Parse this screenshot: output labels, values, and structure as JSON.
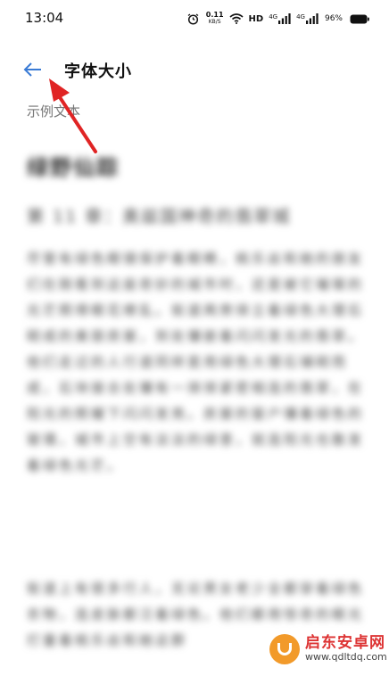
{
  "status_bar": {
    "time": "13:04",
    "net_speed_value": "0.11",
    "net_speed_unit": "KB/S",
    "hd_label": "HD",
    "signal1_label": "4G",
    "signal2_label": "4G",
    "battery_text": "96%",
    "icons": [
      "alarm-icon",
      "wifi-icon",
      "signal-icon",
      "signal-icon",
      "battery-icon"
    ]
  },
  "header": {
    "back_icon": "back-arrow-icon",
    "title": "字体大小"
  },
  "sample": {
    "section_label": "示例文本",
    "title": "绿野仙踪",
    "subtitle": "第 11 章：奥兹国神奇的翡翠城",
    "paragraph1": "尽管有绿色眼镜保护着眼睛，桃乐丝和她的朋友们在刚看到这座奇妙的城市时，还是被它璀璨的光芒照得眼花缭乱。街道两旁排立着绿色大理石砌成的美丽房屋，到处镶嵌着闪闪发光的翡翠。他们走过的人行道同样是用绿色大理石铺砌而成，石块接合处镶有一排排紧密相连的翡翠，在阳光的照耀下闪闪发亮。房屋的窗户镶着绿色的玻璃，城市上空有淡淡的绿意，就连阳光也散发着绿色光芒。",
    "paragraph2": "街道上有很多行人，无论男女老少全都穿着绿色衣物，连皮肤都泛着绿色。他们都用惊奇的眼光打量着桃乐丝和她这群"
  },
  "watermark": {
    "brand": "启东安卓网",
    "url": "www.qdltdq.com"
  },
  "colors": {
    "accent_blue": "#3a7bd5",
    "annotation_red": "#e02424",
    "watermark_orange": "#f29a2a"
  }
}
